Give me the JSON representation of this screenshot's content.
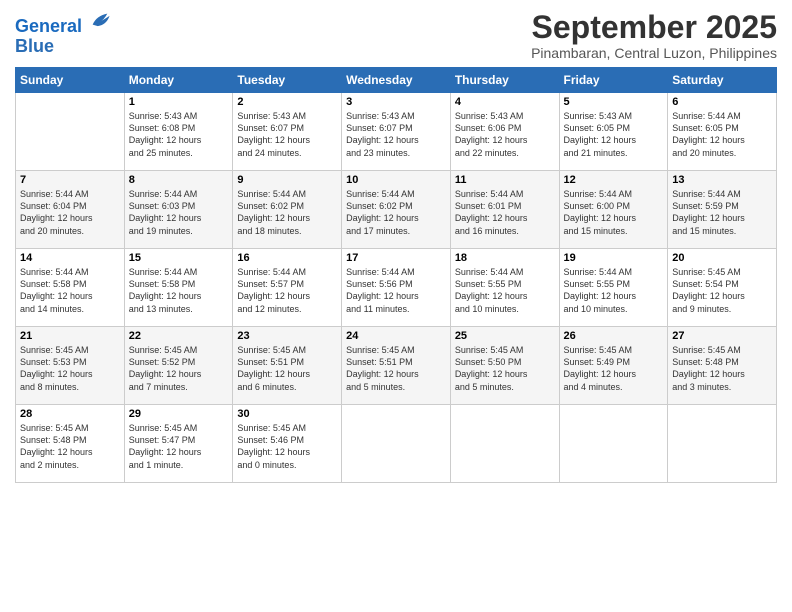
{
  "logo": {
    "line1": "General",
    "line2": "Blue"
  },
  "title": "September 2025",
  "subtitle": "Pinambaran, Central Luzon, Philippines",
  "headers": [
    "Sunday",
    "Monday",
    "Tuesday",
    "Wednesday",
    "Thursday",
    "Friday",
    "Saturday"
  ],
  "weeks": [
    [
      {
        "day": "",
        "info": ""
      },
      {
        "day": "1",
        "info": "Sunrise: 5:43 AM\nSunset: 6:08 PM\nDaylight: 12 hours\nand 25 minutes."
      },
      {
        "day": "2",
        "info": "Sunrise: 5:43 AM\nSunset: 6:07 PM\nDaylight: 12 hours\nand 24 minutes."
      },
      {
        "day": "3",
        "info": "Sunrise: 5:43 AM\nSunset: 6:07 PM\nDaylight: 12 hours\nand 23 minutes."
      },
      {
        "day": "4",
        "info": "Sunrise: 5:43 AM\nSunset: 6:06 PM\nDaylight: 12 hours\nand 22 minutes."
      },
      {
        "day": "5",
        "info": "Sunrise: 5:43 AM\nSunset: 6:05 PM\nDaylight: 12 hours\nand 21 minutes."
      },
      {
        "day": "6",
        "info": "Sunrise: 5:44 AM\nSunset: 6:05 PM\nDaylight: 12 hours\nand 20 minutes."
      }
    ],
    [
      {
        "day": "7",
        "info": "Sunrise: 5:44 AM\nSunset: 6:04 PM\nDaylight: 12 hours\nand 20 minutes."
      },
      {
        "day": "8",
        "info": "Sunrise: 5:44 AM\nSunset: 6:03 PM\nDaylight: 12 hours\nand 19 minutes."
      },
      {
        "day": "9",
        "info": "Sunrise: 5:44 AM\nSunset: 6:02 PM\nDaylight: 12 hours\nand 18 minutes."
      },
      {
        "day": "10",
        "info": "Sunrise: 5:44 AM\nSunset: 6:02 PM\nDaylight: 12 hours\nand 17 minutes."
      },
      {
        "day": "11",
        "info": "Sunrise: 5:44 AM\nSunset: 6:01 PM\nDaylight: 12 hours\nand 16 minutes."
      },
      {
        "day": "12",
        "info": "Sunrise: 5:44 AM\nSunset: 6:00 PM\nDaylight: 12 hours\nand 15 minutes."
      },
      {
        "day": "13",
        "info": "Sunrise: 5:44 AM\nSunset: 5:59 PM\nDaylight: 12 hours\nand 15 minutes."
      }
    ],
    [
      {
        "day": "14",
        "info": "Sunrise: 5:44 AM\nSunset: 5:58 PM\nDaylight: 12 hours\nand 14 minutes."
      },
      {
        "day": "15",
        "info": "Sunrise: 5:44 AM\nSunset: 5:58 PM\nDaylight: 12 hours\nand 13 minutes."
      },
      {
        "day": "16",
        "info": "Sunrise: 5:44 AM\nSunset: 5:57 PM\nDaylight: 12 hours\nand 12 minutes."
      },
      {
        "day": "17",
        "info": "Sunrise: 5:44 AM\nSunset: 5:56 PM\nDaylight: 12 hours\nand 11 minutes."
      },
      {
        "day": "18",
        "info": "Sunrise: 5:44 AM\nSunset: 5:55 PM\nDaylight: 12 hours\nand 10 minutes."
      },
      {
        "day": "19",
        "info": "Sunrise: 5:44 AM\nSunset: 5:55 PM\nDaylight: 12 hours\nand 10 minutes."
      },
      {
        "day": "20",
        "info": "Sunrise: 5:45 AM\nSunset: 5:54 PM\nDaylight: 12 hours\nand 9 minutes."
      }
    ],
    [
      {
        "day": "21",
        "info": "Sunrise: 5:45 AM\nSunset: 5:53 PM\nDaylight: 12 hours\nand 8 minutes."
      },
      {
        "day": "22",
        "info": "Sunrise: 5:45 AM\nSunset: 5:52 PM\nDaylight: 12 hours\nand 7 minutes."
      },
      {
        "day": "23",
        "info": "Sunrise: 5:45 AM\nSunset: 5:51 PM\nDaylight: 12 hours\nand 6 minutes."
      },
      {
        "day": "24",
        "info": "Sunrise: 5:45 AM\nSunset: 5:51 PM\nDaylight: 12 hours\nand 5 minutes."
      },
      {
        "day": "25",
        "info": "Sunrise: 5:45 AM\nSunset: 5:50 PM\nDaylight: 12 hours\nand 5 minutes."
      },
      {
        "day": "26",
        "info": "Sunrise: 5:45 AM\nSunset: 5:49 PM\nDaylight: 12 hours\nand 4 minutes."
      },
      {
        "day": "27",
        "info": "Sunrise: 5:45 AM\nSunset: 5:48 PM\nDaylight: 12 hours\nand 3 minutes."
      }
    ],
    [
      {
        "day": "28",
        "info": "Sunrise: 5:45 AM\nSunset: 5:48 PM\nDaylight: 12 hours\nand 2 minutes."
      },
      {
        "day": "29",
        "info": "Sunrise: 5:45 AM\nSunset: 5:47 PM\nDaylight: 12 hours\nand 1 minute."
      },
      {
        "day": "30",
        "info": "Sunrise: 5:45 AM\nSunset: 5:46 PM\nDaylight: 12 hours\nand 0 minutes."
      },
      {
        "day": "",
        "info": ""
      },
      {
        "day": "",
        "info": ""
      },
      {
        "day": "",
        "info": ""
      },
      {
        "day": "",
        "info": ""
      }
    ]
  ]
}
